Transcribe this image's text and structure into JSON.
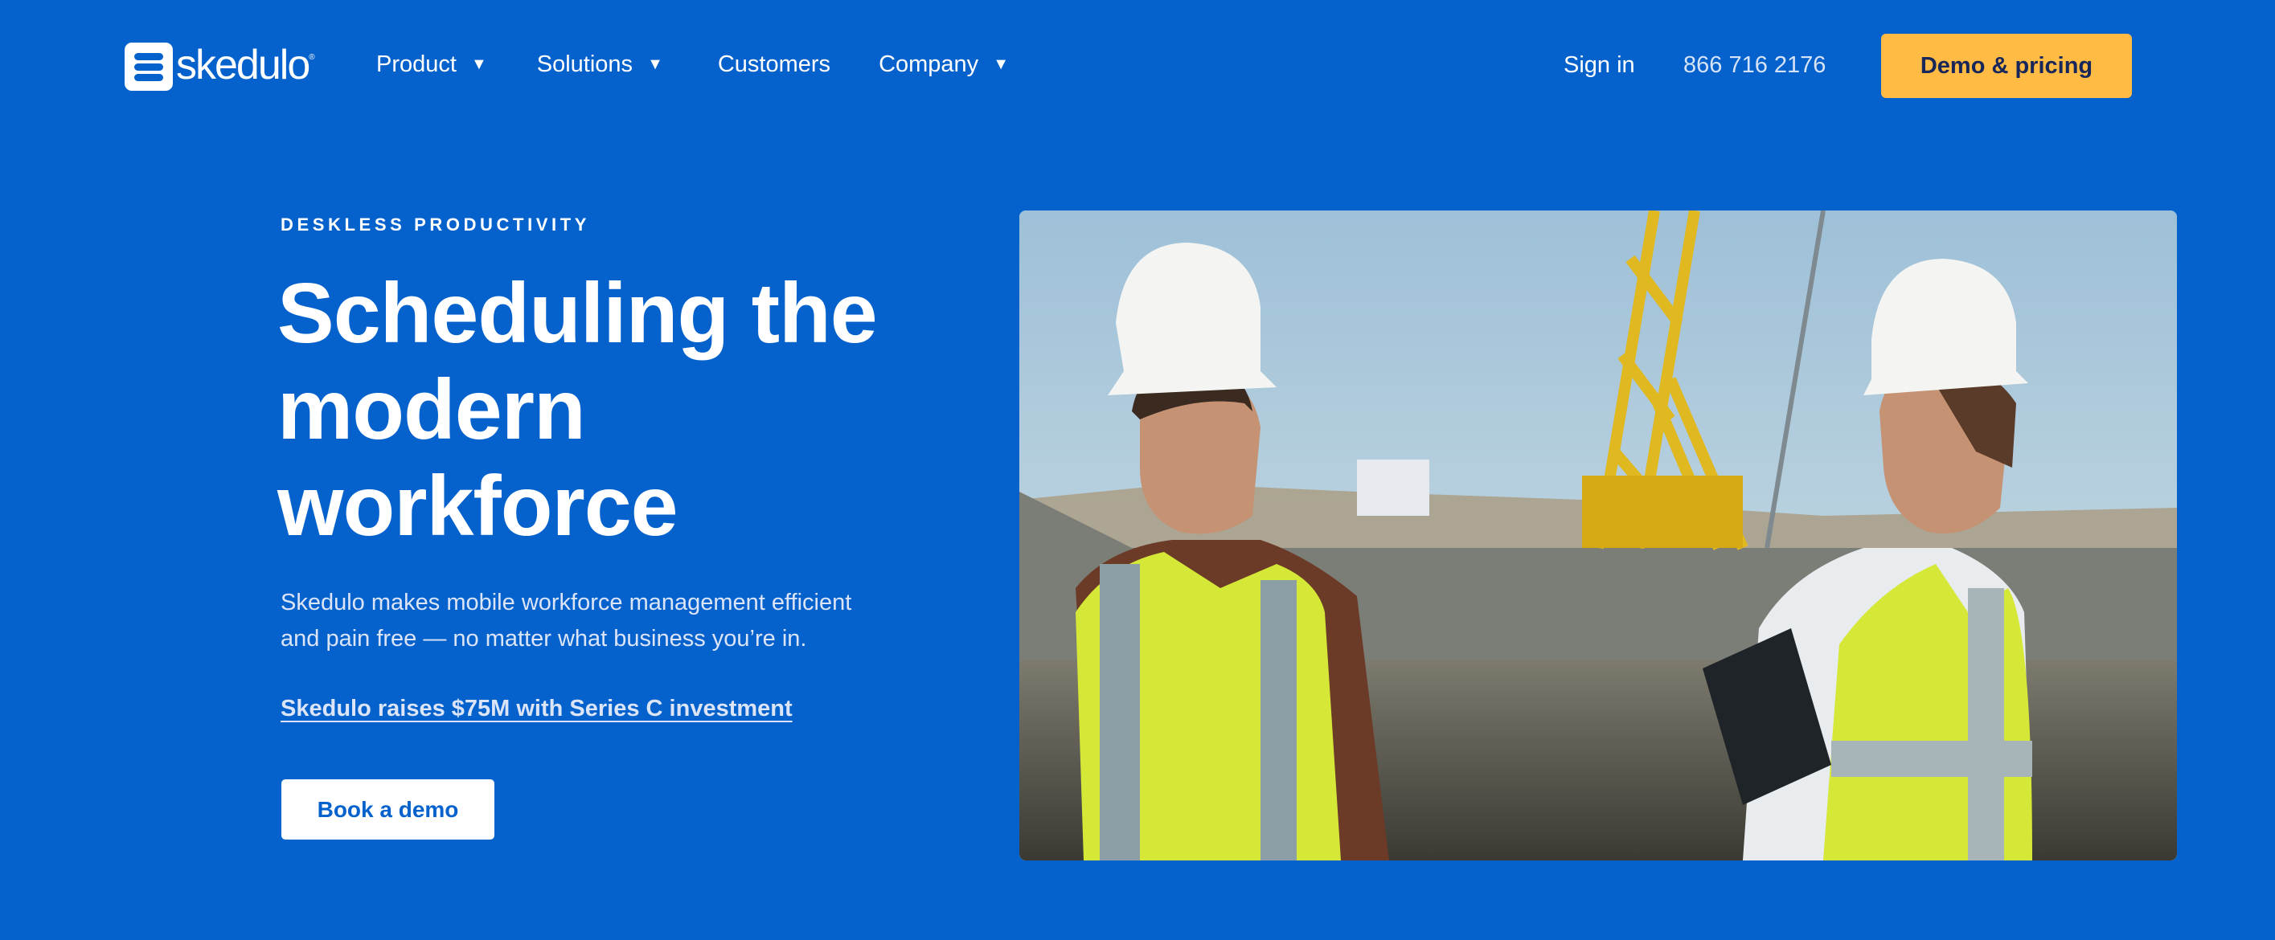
{
  "header": {
    "logo_text": "skedulo",
    "logo_reg": "®",
    "nav": [
      {
        "label": "Product",
        "has_dropdown": true
      },
      {
        "label": "Solutions",
        "has_dropdown": true
      },
      {
        "label": "Customers",
        "has_dropdown": false
      },
      {
        "label": "Company",
        "has_dropdown": true
      }
    ],
    "caret_glyph": "▼",
    "sign_in": "Sign in",
    "phone": "866 716 2176",
    "cta": "Demo & pricing"
  },
  "hero": {
    "eyebrow": "DESKLESS PRODUCTIVITY",
    "headline_lines": [
      "Scheduling the",
      "modern",
      "workforce"
    ],
    "lede_lines": [
      "Skedulo makes mobile workforce management efficient",
      "and pain free — no matter what business you’re in."
    ],
    "news_link": "Skedulo raises $75M with Series C investment",
    "primary_button": "Book a demo",
    "image_alt": "Two construction workers in white hard hats and yellow safety vests reviewing a tablet at a construction site with a yellow crane"
  },
  "colors": {
    "background": "#0562CD",
    "cta_bg": "#FFBB44",
    "cta_text": "#18275A",
    "button_bg": "#FFFFFF",
    "button_text": "#0562CD",
    "lede_text": "#DBE5F7"
  }
}
